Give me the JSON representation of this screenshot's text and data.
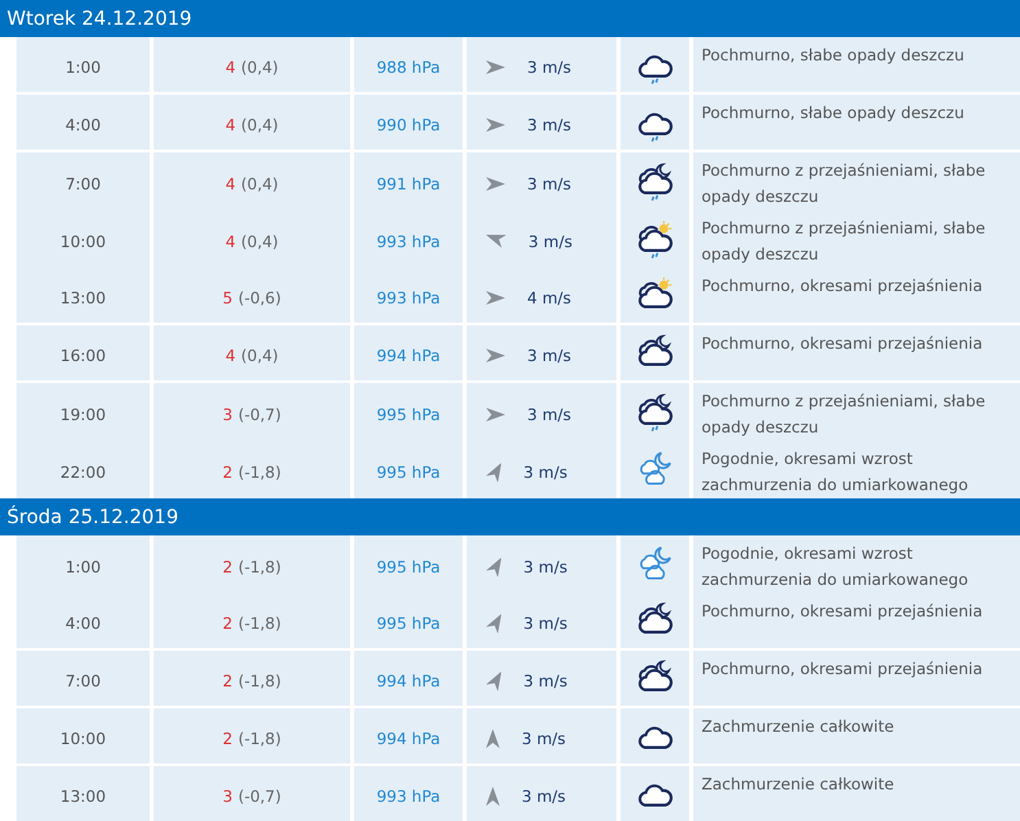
{
  "days": [
    {
      "title": "Wtorek 24.12.2019",
      "rows": [
        {
          "time": "1:00",
          "temp": "4",
          "feels": "(0,4)",
          "pressure": "988 hPa",
          "wind": {
            "kind": "E",
            "speed": "3 m/s"
          },
          "icon": {
            "kind": "cloud-rain"
          },
          "description": "Pochmurno, słabe opady deszczu"
        },
        {
          "time": "4:00",
          "temp": "4",
          "feels": "(0,4)",
          "pressure": "990 hPa",
          "wind": {
            "kind": "E",
            "speed": "3 m/s"
          },
          "icon": {
            "kind": "cloud-rain"
          },
          "description": "Pochmurno, słabe opady deszczu"
        },
        {
          "time": "7:00",
          "temp": "4",
          "feels": "(0,4)",
          "pressure": "991 hPa",
          "wind": {
            "kind": "E",
            "speed": "3 m/s"
          },
          "icon": {
            "kind": "moon-cloud-rain"
          },
          "description": "Pochmurno z przejaśnieniami, słabe opady deszczu"
        },
        {
          "time": "10:00",
          "temp": "4",
          "feels": "(0,4)",
          "pressure": "993 hPa",
          "wind": {
            "kind": "WNW",
            "speed": "3 m/s"
          },
          "icon": {
            "kind": "sun-cloud-rain"
          },
          "description": "Pochmurno z przejaśnieniami, słabe opady deszczu"
        },
        {
          "time": "13:00",
          "temp": "5",
          "feels": "(-0,6)",
          "pressure": "993 hPa",
          "wind": {
            "kind": "E",
            "speed": "4 m/s"
          },
          "icon": {
            "kind": "sun-cloud"
          },
          "description": "Pochmurno, okresami przejaśnienia"
        },
        {
          "time": "16:00",
          "temp": "4",
          "feels": "(0,4)",
          "pressure": "994 hPa",
          "wind": {
            "kind": "E",
            "speed": "3 m/s"
          },
          "icon": {
            "kind": "moon-cloud"
          },
          "description": "Pochmurno, okresami przejaśnienia"
        },
        {
          "time": "19:00",
          "temp": "3",
          "feels": "(-0,7)",
          "pressure": "995 hPa",
          "wind": {
            "kind": "E",
            "speed": "3 m/s"
          },
          "icon": {
            "kind": "moon-cloud-rain"
          },
          "description": "Pochmurno z przejaśnieniami, słabe opady deszczu"
        },
        {
          "time": "22:00",
          "temp": "2",
          "feels": "(-1,8)",
          "pressure": "995 hPa",
          "wind": {
            "kind": "NNE",
            "speed": "3 m/s"
          },
          "icon": {
            "kind": "moon-light-cloud"
          },
          "description": "Pogodnie, okresami wzrost zachmurzenia do umiarkowanego"
        }
      ]
    },
    {
      "title": "Środa 25.12.2019",
      "rows": [
        {
          "time": "1:00",
          "temp": "2",
          "feels": "(-1,8)",
          "pressure": "995 hPa",
          "wind": {
            "kind": "NNE",
            "speed": "3 m/s"
          },
          "icon": {
            "kind": "moon-light-cloud"
          },
          "description": "Pogodnie, okresami wzrost zachmurzenia do umiarkowanego"
        },
        {
          "time": "4:00",
          "temp": "2",
          "feels": "(-1,8)",
          "pressure": "995 hPa",
          "wind": {
            "kind": "NNE",
            "speed": "3 m/s"
          },
          "icon": {
            "kind": "moon-cloud"
          },
          "description": "Pochmurno, okresami przejaśnienia"
        },
        {
          "time": "7:00",
          "temp": "2",
          "feels": "(-1,8)",
          "pressure": "994 hPa",
          "wind": {
            "kind": "NNE",
            "speed": "3 m/s"
          },
          "icon": {
            "kind": "moon-cloud"
          },
          "description": "Pochmurno, okresami przejaśnienia"
        },
        {
          "time": "10:00",
          "temp": "2",
          "feels": "(-1,8)",
          "pressure": "994 hPa",
          "wind": {
            "kind": "N",
            "speed": "3 m/s"
          },
          "icon": {
            "kind": "cloud"
          },
          "description": "Zachmurzenie całkowite"
        },
        {
          "time": "13:00",
          "temp": "3",
          "feels": "(-0,7)",
          "pressure": "993 hPa",
          "wind": {
            "kind": "N",
            "speed": "3 m/s"
          },
          "icon": {
            "kind": "cloud"
          },
          "description": "Zachmurzenie całkowite"
        }
      ]
    }
  ]
}
